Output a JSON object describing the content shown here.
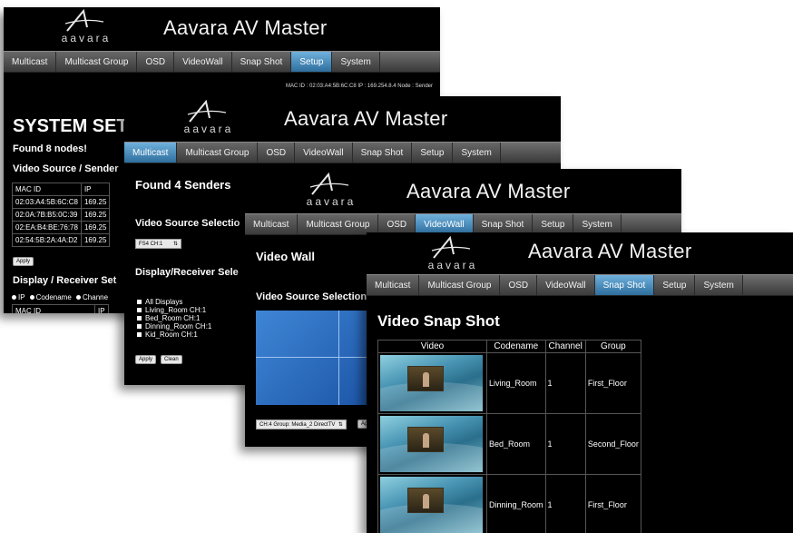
{
  "app": {
    "title": "Aavara AV Master",
    "logo_text": "aavara",
    "logo_icon": "aavara-swoosh-logo"
  },
  "colors": {
    "active_tab": "#4a8cc0",
    "background": "#000000",
    "nav_bar": "#4a4a4a"
  },
  "nav_tabs": [
    "Multicast",
    "Multicast Group",
    "OSD",
    "VideoWall",
    "Snap Shot",
    "Setup",
    "System"
  ],
  "win1": {
    "active_tab": "Setup",
    "status": "MAC ID : 02:03:A4:5B:6C:C8 IP : 169.254.8.4 Node : Sender",
    "heading": "SYSTEM SETU",
    "found": "Found 8 nodes!",
    "section1": "Video Source / Sender",
    "table_headers": [
      "MAC ID",
      "IP"
    ],
    "rows": [
      [
        "02:03:A4:5B:6C:C8",
        "169.25"
      ],
      [
        "02:0A:7B:B5:0C:39",
        "169.25"
      ],
      [
        "02:EA:B4:BE:76:78",
        "169.25"
      ],
      [
        "02:54:5B:2A:4A:D2",
        "169.25"
      ]
    ],
    "apply": "Apply",
    "section2": "Display / Receiver Set",
    "radio_options": [
      "IP",
      "Codename",
      "Channe"
    ],
    "table2_headers": [
      "MAC ID",
      "IP"
    ]
  },
  "win2": {
    "active_tab": "Multicast",
    "found": "Found 4 Senders",
    "source_label": "Video Source Selectio",
    "select_value": "FS4 CH:1",
    "display_label": "Display/Receiver Sele",
    "checklist": [
      "All Displays",
      "Living_Room CH:1",
      "Bed_Room CH:1",
      "Dinning_Room CH:1",
      "Kid_Room CH:1"
    ],
    "apply": "Apply",
    "clean": "Clean"
  },
  "win3": {
    "active_tab": "VideoWall",
    "heading": "Video Wall",
    "source_label": "Video Source Selection",
    "select_value": "CH:4 Group: Media_2 DirectTV",
    "button": "Ap"
  },
  "win4": {
    "active_tab": "Snap Shot",
    "heading": "Video Snap Shot",
    "table_headers": [
      "Video",
      "Codename",
      "Channel",
      "Group"
    ],
    "rows": [
      {
        "codename": "Living_Room",
        "channel": "1",
        "group": "First_Floor"
      },
      {
        "codename": "Bed_Room",
        "channel": "1",
        "group": "Second_Floor"
      },
      {
        "codename": "Dinning_Room",
        "channel": "1",
        "group": "First_Floor"
      }
    ]
  }
}
